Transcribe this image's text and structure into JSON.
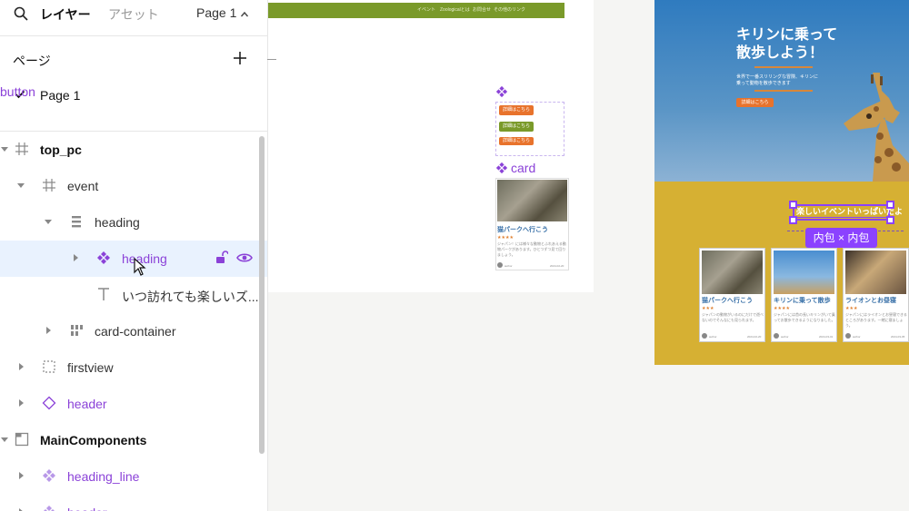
{
  "tabs": {
    "layers": "レイヤー",
    "assets": "アセット",
    "page": "Page 1"
  },
  "pages": {
    "header": "ページ",
    "items": [
      "Page 1"
    ]
  },
  "layers": [
    {
      "label": "top_pc",
      "icon": "frame-icon"
    },
    {
      "label": "event",
      "icon": "frame-icon"
    },
    {
      "label": "heading",
      "icon": "auto-layout-icon"
    },
    {
      "label": "heading",
      "icon": "component-instance-icon"
    },
    {
      "label": "いつ訪れても楽しいズ...",
      "icon": "text-icon"
    },
    {
      "label": "card-container",
      "icon": "auto-layout-grid-icon"
    },
    {
      "label": "firstview",
      "icon": "group-icon"
    },
    {
      "label": "header",
      "icon": "instance-icon"
    },
    {
      "label": "MainComponents",
      "icon": "section-icon"
    },
    {
      "label": "heading_line",
      "icon": "component-icon"
    },
    {
      "label": "header",
      "icon": "component-icon"
    }
  ],
  "canvas": {
    "nav": [
      "イベント",
      "Zoologicalとは",
      "お問合せ",
      "その他のリンク"
    ],
    "button_component": {
      "name": "button",
      "buttons": [
        "詳細はこちら",
        "詳細はこちら",
        "詳細はこちら"
      ]
    },
    "card_component": {
      "name": "card",
      "title": "猫パークへ行こう",
      "stars": "★★★★",
      "text": "ジャパン！には様々な動物とふれあえる動物パークがあります。ひとつずつ見て回りましょう。",
      "author": "author",
      "date": "2024-02-20"
    }
  },
  "site": {
    "hero_title_1": "キリンに乗って",
    "hero_title_2": "散歩しよう！",
    "hero_sub_1": "世界で一番スリリングな冒険、キリンに",
    "hero_sub_2": "乗って動物を散歩できます",
    "hero_button": "詳細はこちら",
    "section_heading": "楽しいイベントいっぱいだよ",
    "badge": "内包 × 内包",
    "cards": [
      {
        "title": "猫パークへ行こう",
        "stars": "★★★",
        "text": "ジャパンの動物がいるのにだけで遊べないのでそんなにも見られます。",
        "author": "author",
        "date": "2024-02-20"
      },
      {
        "title": "キリンに乗って散歩",
        "stars": "★★★★",
        "text": "ジャパンには首の長いキリンがいて乗ってお散歩できるようになりました。",
        "author": "author",
        "date": "2024-03-01"
      },
      {
        "title": "ライオンとお昼寝",
        "stars": "★★★",
        "text": "ジャパンにはライオンとお昼寝できるところがあります。一緒に寝ましょう。",
        "author": "author",
        "date": "2024-03-05"
      }
    ]
  },
  "colors": {
    "accent": "#8b42ff",
    "component": "#8b42d8",
    "nav": "#7a9a2a",
    "orange": "#e8732c",
    "yellow": "#d6b033",
    "sky": "#2f7bbf"
  }
}
